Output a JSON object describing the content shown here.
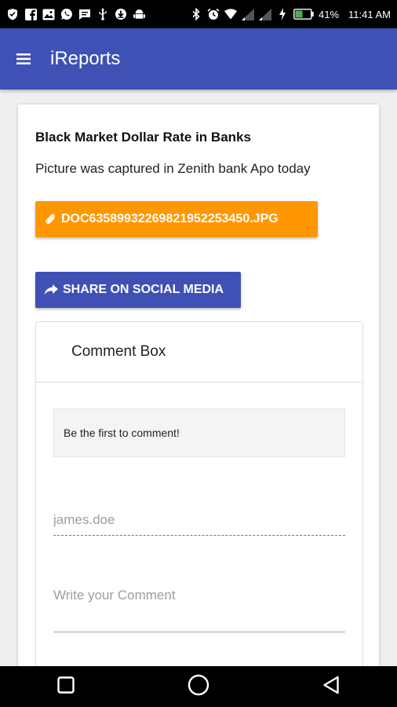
{
  "status_bar": {
    "battery_percent": "41%",
    "time": "11:41 AM",
    "left_icons": [
      "shield-icon",
      "facebook-icon",
      "image-icon",
      "whatsapp-icon",
      "message-icon",
      "usb-icon",
      "download-icon",
      "android-icon"
    ],
    "right_icons": [
      "bluetooth-icon",
      "alarm-icon",
      "wifi-icon",
      "signal-icon",
      "signal-icon",
      "charging-icon",
      "battery-icon"
    ]
  },
  "app_bar": {
    "title": "iReports",
    "menu_icon": "hamburger-menu-icon",
    "color": "#3f51b5"
  },
  "post": {
    "title": "Black Market Dollar Rate in Banks",
    "description": "Picture was captured in Zenith bank Apo today",
    "attachment_label": "DOC6358993226982195225345​0.JPG",
    "attachment_icon": "paperclip-icon",
    "attachment_color": "#ff9800",
    "share_label": "SHARE ON SOCIAL MEDIA",
    "share_icon": "share-arrow-icon",
    "share_color": "#3f51b5"
  },
  "comments": {
    "header": "Comment Box",
    "empty_message": "Be the first to comment!",
    "name_placeholder": "james.doe",
    "comment_placeholder": "Write your Comment"
  },
  "nav_bar": {
    "buttons": [
      "recent-apps-icon",
      "home-icon",
      "back-icon"
    ]
  }
}
